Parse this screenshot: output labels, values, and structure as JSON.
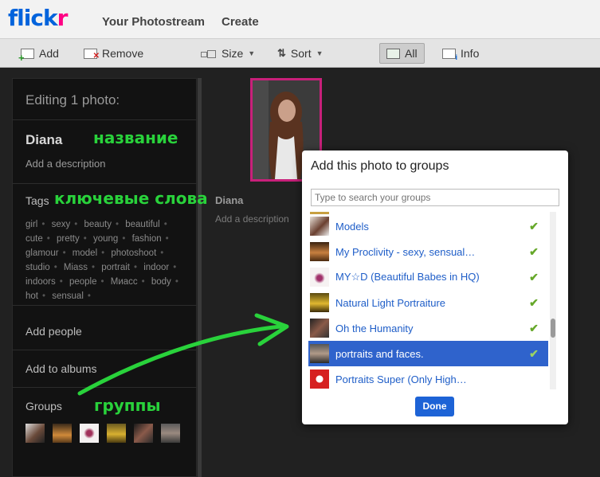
{
  "logo": {
    "part1": "flick",
    "part2": "r"
  },
  "nav": {
    "photostream": "Your Photostream",
    "create": "Create"
  },
  "toolbar": {
    "add": "Add",
    "remove": "Remove",
    "size": "Size",
    "sort": "Sort",
    "all": "All",
    "info": "Info"
  },
  "editor": {
    "heading": "Editing 1 photo:",
    "title": "Diana",
    "description_placeholder": "Add a description",
    "tags_label": "Tags",
    "tags": [
      "girl",
      "sexy",
      "beauty",
      "beautiful",
      "cute",
      "pretty",
      "young",
      "fashion",
      "glamour",
      "model",
      "photoshoot",
      "studio",
      "Miass",
      "portrait",
      "indoor",
      "indoors",
      "people",
      "Миасс",
      "body",
      "hot",
      "sensual"
    ],
    "add_people": "Add people",
    "add_albums": "Add to albums",
    "groups_label": "Groups"
  },
  "annotations": {
    "title": "название",
    "tags": "ключевые слова",
    "groups": "группы"
  },
  "photo": {
    "name": "Diana",
    "description_placeholder": "Add a description"
  },
  "modal": {
    "title": "Add this photo to groups",
    "search_placeholder": "Type to search your groups",
    "groups": [
      {
        "name": "Models",
        "checked": true,
        "selected": false
      },
      {
        "name": "My Proclivity - sexy, sensual…",
        "checked": true,
        "selected": false
      },
      {
        "name": "MY☆D (Beautiful Babes in HQ)",
        "checked": true,
        "selected": false
      },
      {
        "name": "Natural Light Portraiture",
        "checked": true,
        "selected": false
      },
      {
        "name": "Oh the Humanity",
        "checked": true,
        "selected": false
      },
      {
        "name": "portraits and faces.",
        "checked": true,
        "selected": true
      },
      {
        "name": "Portraits Super (Only High…",
        "checked": false,
        "selected": false
      }
    ],
    "done": "Done"
  },
  "colors": {
    "accent": "#0063dc",
    "pink": "#ff0084",
    "annotation": "#29d23b",
    "selected_row": "#2f63cc"
  }
}
